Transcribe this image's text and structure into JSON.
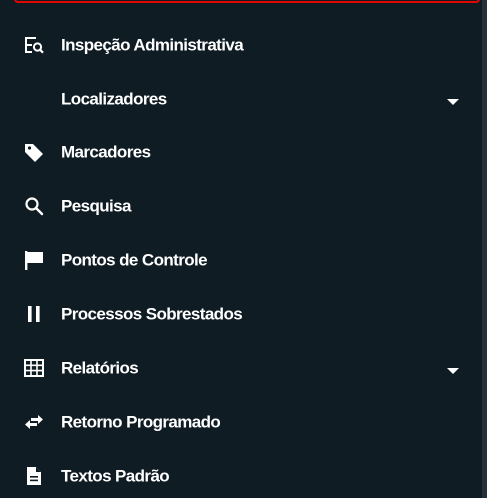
{
  "menu": {
    "items": [
      {
        "label": "Inspeção Administrativa",
        "icon": "magnifier-list-icon"
      },
      {
        "label": "Localizadores",
        "icon": "none",
        "expandable": true
      },
      {
        "label": "Marcadores",
        "icon": "tag-icon"
      },
      {
        "label": "Pesquisa",
        "icon": "search-icon"
      },
      {
        "label": "Pontos de Controle",
        "icon": "flag-icon"
      },
      {
        "label": "Processos Sobrestados",
        "icon": "pause-icon"
      },
      {
        "label": "Relatórios",
        "icon": "table-grid-icon",
        "expandable": true
      },
      {
        "label": "Retorno Programado",
        "icon": "exchange-arrows-icon"
      },
      {
        "label": "Textos Padrão",
        "icon": "document-icon"
      }
    ]
  },
  "colors": {
    "background": "#0f1c24",
    "text": "#ffffff",
    "highlight_border": "#e10600",
    "scrollbar": "#24313a"
  }
}
